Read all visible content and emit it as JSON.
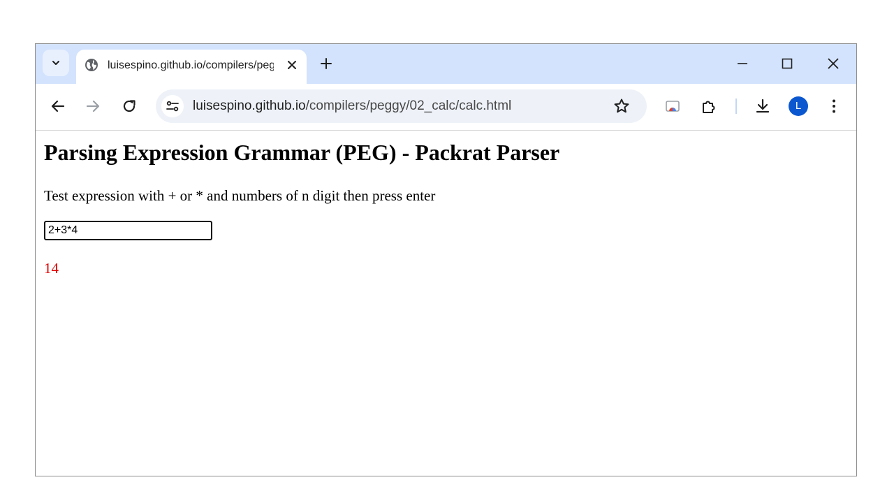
{
  "browser": {
    "tab": {
      "title": "luisespino.github.io/compilers/peggy/02_calc/calc.html",
      "favicon": "globe-icon"
    },
    "url": {
      "host": "luisespino.github.io",
      "path": "/compilers/peggy/02_calc/calc.html"
    },
    "profile_initial": "L",
    "icons": {
      "tab_search": "chevron-down-icon",
      "tab_close": "close-icon",
      "new_tab": "plus-icon",
      "minimize": "minimize-icon",
      "maximize": "maximize-icon",
      "close_window": "close-icon",
      "back": "back-arrow-icon",
      "forward": "forward-arrow-icon",
      "reload": "reload-icon",
      "site_info": "tune-icon",
      "bookmark": "star-icon",
      "cast": "cast-icon",
      "extensions": "puzzle-icon",
      "downloads": "download-icon",
      "menu": "kebab-menu-icon"
    },
    "colors": {
      "tabstrip": "#d3e3fd",
      "omnibox": "#eef2f8",
      "avatar": "#0b57d0"
    }
  },
  "page": {
    "title": "Parsing Expression Grammar (PEG) - Packrat Parser",
    "instructions": "Test expression with + or * and numbers of n digit then press enter",
    "input_value": "2+3*4",
    "result": "14",
    "result_color": "#e00000"
  }
}
